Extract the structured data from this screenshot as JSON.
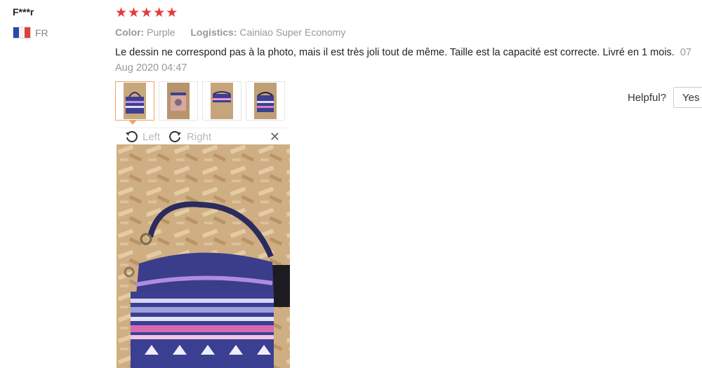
{
  "reviewer": {
    "name": "F***r",
    "country": "FR"
  },
  "rating": {
    "stars": 5,
    "max": 5,
    "color": "#e4393c"
  },
  "meta": {
    "color_label": "Color:",
    "color_value": "Purple",
    "logistics_label": "Logistics:",
    "logistics_value": "Cainiao Super Economy"
  },
  "review": {
    "text": "Le dessin ne correspond pas à la photo, mais il est très joli tout de même. Taille est la capacité est correcte. Livré en 1 mois.",
    "date": "07 Aug 2020 04:47"
  },
  "thumbnails": [
    {
      "icon": "photo-thumbnail",
      "selected": true
    },
    {
      "icon": "photo-thumbnail",
      "selected": false
    },
    {
      "icon": "photo-thumbnail",
      "selected": false
    },
    {
      "icon": "photo-thumbnail",
      "selected": false
    }
  ],
  "viewer": {
    "rotate_left_label": "Left",
    "rotate_right_label": "Right",
    "close_icon": "close-icon"
  },
  "helpful": {
    "label": "Helpful?",
    "yes_label": "Yes"
  }
}
